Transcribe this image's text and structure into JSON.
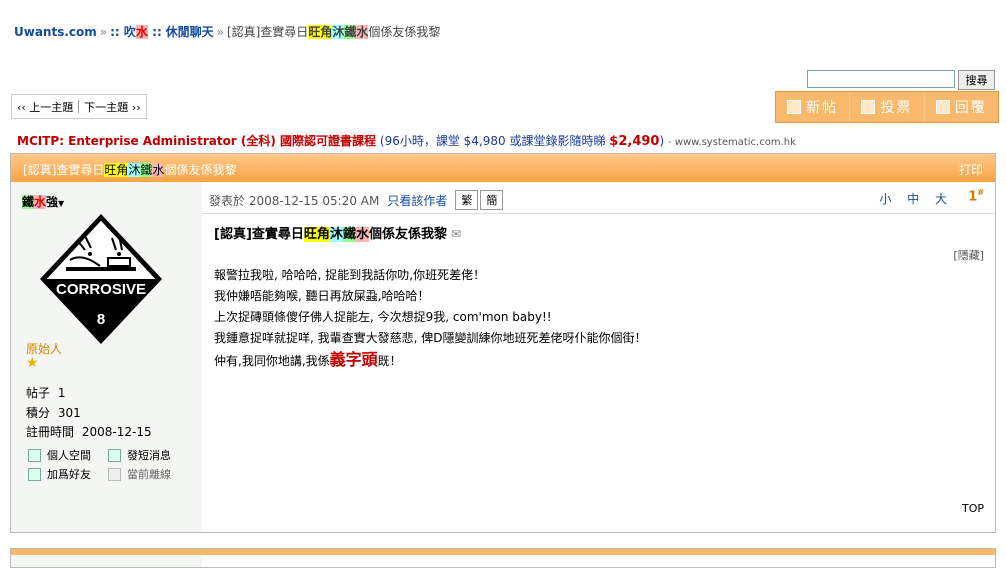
{
  "breadcrumb": {
    "site": "Uwants.com",
    "sep": "»",
    "forum_prefix": "::",
    "forum_a": "吹",
    "forum_b": "水",
    "forum_suffix": "::",
    "subforum": "休閒聊天",
    "thread_prefix": "[認真]查實尋日",
    "t1": "旺",
    "t2": "角",
    "t3": "沐",
    "t4": "鐵",
    "t5": "水",
    "thread_suffix": "個係友係我黎"
  },
  "search": {
    "placeholder": "",
    "button_label": "搜尋"
  },
  "thread_nav": {
    "prev": "‹‹ 上一主題",
    "next": "下一主題 ››"
  },
  "actions": {
    "new_thread": "新帖",
    "poll": "投票",
    "reply": "回覆"
  },
  "ad": {
    "title": "MCITP: Enterprise Administrator (全科) 國際認可證書課程",
    "detail": "(96小時，課堂 $4,980 或課堂錄影隨時睇",
    "price": "$2,490",
    "close": ")",
    "url": "- www.systematic.com.hk"
  },
  "post": {
    "header_title_prefix": "[認真]查實尋日",
    "header_title_suffix": "個係友係我黎",
    "print": "打印",
    "author": {
      "a": "鐵",
      "b": "水",
      "c": "強",
      "dropdown": "▼"
    },
    "avatar": {
      "text": "CORROSIVE",
      "class_number": "8"
    },
    "rank": "原始人",
    "rank_star": "★",
    "stats": {
      "posts_label": "帖子",
      "posts": "1",
      "points_label": "積分",
      "points": "301",
      "reg_label": "註冊時間",
      "reg_date": "2008-12-15"
    },
    "links": {
      "profile": "個人空間",
      "message": "發短消息",
      "add_friend": "加爲好友",
      "status": "當前離線"
    },
    "meta": {
      "posted": "發表於 2008-12-15 05:20 AM",
      "author_only": "只看該作者",
      "trad": "繁",
      "simp": "簡"
    },
    "font_size": "小 中 大",
    "floor": "1",
    "floor_sup": "#",
    "title_prefix": "[認真]查實尋日",
    "title_suffix": "個係友係我黎",
    "mail_icon": "✉",
    "hide": "[隱藏]",
    "body": {
      "line1": "報警拉我啦, 哈哈哈, 捉能到我話你叻,你班死差佬！",
      "line2": "我仲嫌唔能夠喉, 聽日再放屎蝨,哈哈哈！",
      "line3": "上次捉磚頭條傻仔佛人捉能左, 今次想捉9我, com'mon baby!!",
      "line4": "我鍾意捉咩就捉咩, 我輩查實大發慈悲, 俾D隱變訓練你地班死差佬呀仆能你個街！",
      "line5_prefix": "仲有,我同你地講,我係",
      "line5_big": "義字頭",
      "line5_suffix": "既！"
    },
    "top": "TOP"
  },
  "colors": {
    "header_orange": "#f9a445",
    "link_blue": "#154ba0",
    "sidebar_bg": "#f3f6f3"
  }
}
